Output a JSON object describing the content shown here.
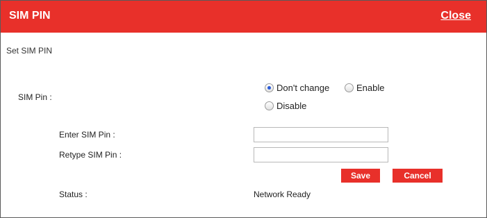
{
  "dialog": {
    "title": "SIM PIN",
    "close_label": "Close",
    "subtitle": "Set SIM PIN"
  },
  "sim_pin": {
    "label": "SIM Pin :",
    "options": {
      "dont_change": "Don't change",
      "enable": "Enable",
      "disable": "Disable"
    },
    "selected": "dont_change"
  },
  "fields": {
    "enter_label": "Enter SIM Pin :",
    "enter_value": "",
    "retype_label": "Retype SIM Pin :",
    "retype_value": ""
  },
  "buttons": {
    "save": "Save",
    "cancel": "Cancel"
  },
  "status": {
    "label": "Status  :",
    "value": "Network Ready"
  },
  "colors": {
    "accent": "#e8302a",
    "radio_selected": "#2a5bd7"
  }
}
